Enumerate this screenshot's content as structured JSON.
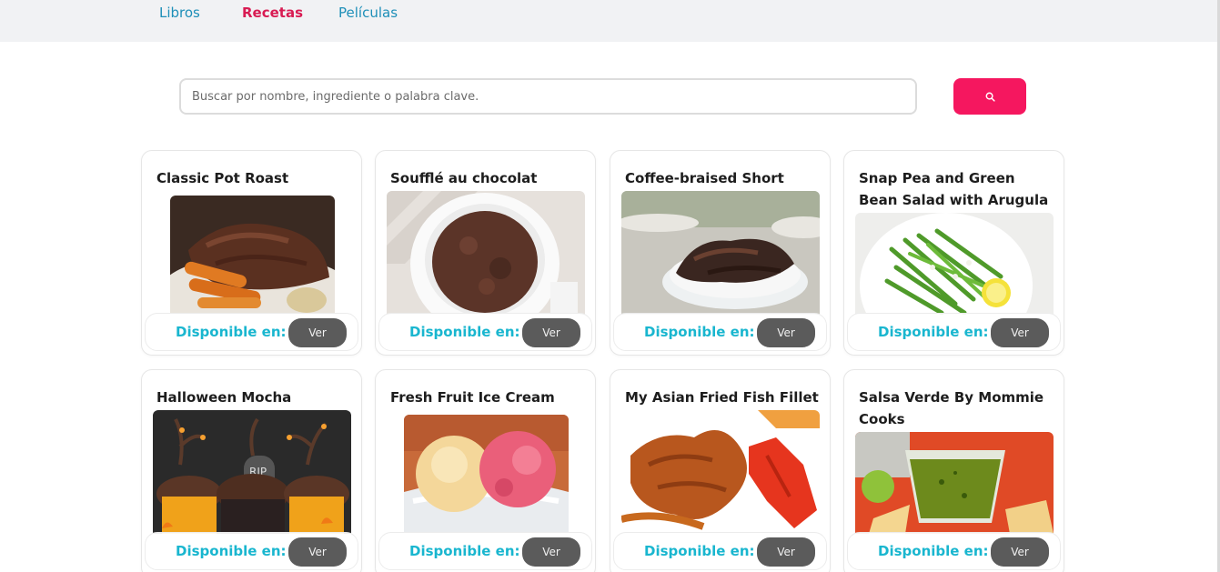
{
  "nav": {
    "items": [
      {
        "label": "Libros",
        "active": false
      },
      {
        "label": "Recetas",
        "active": true
      },
      {
        "label": "Películas",
        "active": false
      }
    ]
  },
  "search": {
    "placeholder": "Buscar por nombre, ingrediente o palabra clave.",
    "value": "",
    "button_icon": "search-icon"
  },
  "colors": {
    "accent": "#f5175f",
    "active_nav": "#d81b52",
    "nav_link": "#1e8fb8",
    "available_text": "#19b6cf",
    "ver_button": "#5b5b5b"
  },
  "recipes": [
    {
      "title": "Classic Pot Roast",
      "available_label": "Disponible en:",
      "button_label": "Ver",
      "image": "pot-roast-photo"
    },
    {
      "title": "Soufflé au chocolat",
      "available_label": "Disponible en:",
      "button_label": "Ver",
      "image": "chocolate-souffle-photo"
    },
    {
      "title": "Coffee-braised Short Ribs",
      "available_label": "Disponible en:",
      "button_label": "Ver",
      "image": "short-ribs-photo"
    },
    {
      "title": "Snap Pea and Green Bean Salad with Arugula Pesto",
      "available_label": "Disponible en:",
      "button_label": "Ver",
      "image": "green-bean-salad-photo"
    },
    {
      "title": "Halloween Mocha Cupcakes",
      "available_label": "Disponible en:",
      "button_label": "Ver",
      "image": "halloween-cupcakes-photo"
    },
    {
      "title": "Fresh Fruit Ice Cream",
      "available_label": "Disponible en:",
      "button_label": "Ver",
      "image": "ice-cream-photo"
    },
    {
      "title": "My Asian Fried Fish Fillet",
      "available_label": "Disponible en:",
      "button_label": "Ver",
      "image": "fried-fish-photo"
    },
    {
      "title": "Salsa Verde By Mommie Cooks",
      "available_label": "Disponible en:",
      "button_label": "Ver",
      "image": "salsa-verde-photo"
    }
  ]
}
